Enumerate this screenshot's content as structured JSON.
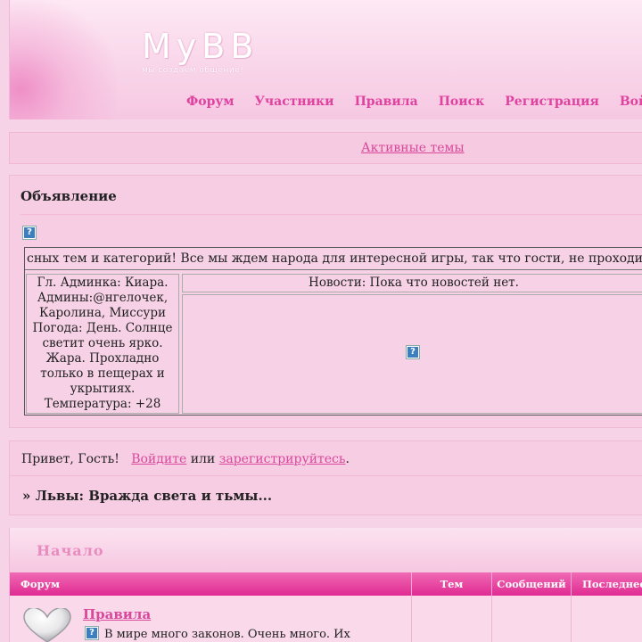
{
  "header": {
    "logo_title": "MyBB",
    "logo_subtitle": "мы создаем общение!",
    "nav": [
      "Форум",
      "Участники",
      "Правила",
      "Поиск",
      "Регистрация",
      "Войти"
    ]
  },
  "active_topics_link": "Активные темы",
  "announcement": {
    "title": "Объявление",
    "marquee_text": "сных тем и категорий! Все мы ждем народа для интересной игры, так что гости, не проходите мимо",
    "info_lines": [
      "Гл. Админка: Киара.",
      "Админы:@нгелочек,",
      "Каролина, Миссури",
      "Погода: День. Солнце",
      "светит очень ярко.",
      "Жара. Прохладно",
      "только в пещерах и",
      "укрытиях.",
      "Температура: +28"
    ],
    "news_header": "Новости: Пока что новостей нет."
  },
  "greeting": {
    "prefix": "Привет, Гость!",
    "login_link": "Войдите",
    "or": "или",
    "register_link": "зарегистрируйтесь",
    "suffix": "."
  },
  "breadcrumb": "» Львы: Вражда света и тьмы...",
  "category": {
    "title": "Начало",
    "columns": [
      "Форум",
      "Тем",
      "Сообщений",
      "Последнее"
    ],
    "forums": [
      {
        "name": "Правила",
        "description": "В мире много законов. Очень много. Их"
      }
    ]
  },
  "colors": {
    "accent": "#e0439f",
    "link": "#d9489b",
    "background": "#f7d3e7",
    "column_header": "#e02a92"
  }
}
